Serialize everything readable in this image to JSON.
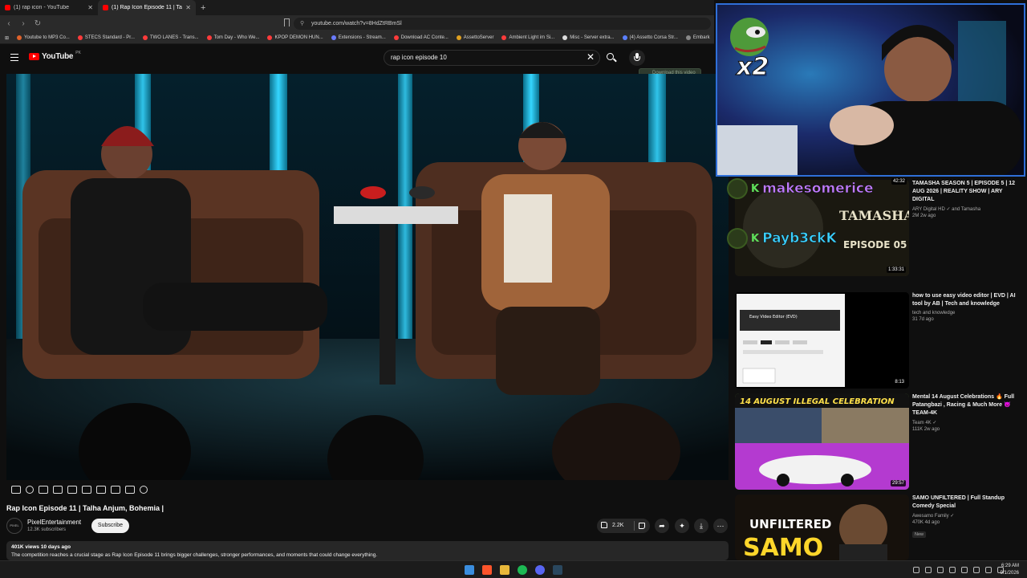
{
  "browser": {
    "tabs": [
      {
        "title": "(1) rap icon - YouTube",
        "active": false
      },
      {
        "title": "(1) Rap Icon Episode 11 | Talha A",
        "active": true
      }
    ],
    "new_tab_label": "+",
    "address": "youtube.com/watch?v=8HdZtRBmSl",
    "bookmarks": [
      {
        "label": "Youtube to MP3 Co...",
        "color": "#e0622a"
      },
      {
        "label": "STECS Standard - Pr...",
        "color": "#ff3b3b"
      },
      {
        "label": "TWO LANES - Trans...",
        "color": "#ff3b3b"
      },
      {
        "label": "Tom Day - Who We...",
        "color": "#ff3b3b"
      },
      {
        "label": "KPOP DEMON HUN...",
        "color": "#ff3b3b"
      },
      {
        "label": "Extensions - Stream...",
        "color": "#6a7bff"
      },
      {
        "label": "Download AC Conte...",
        "color": "#ff3b3b"
      },
      {
        "label": "AssettoServer",
        "color": "#e0a020"
      },
      {
        "label": "Ambient Light im Si...",
        "color": "#ff3b3b"
      },
      {
        "label": "Misc - Server extra...",
        "color": "#dddddd"
      },
      {
        "label": "(4) Assetto Corsa Str...",
        "color": "#5a7fff"
      },
      {
        "label": "Embark",
        "color": "#888888"
      }
    ]
  },
  "youtube": {
    "logo_text": "YouTube",
    "region": "PK",
    "search_value": "rap icon episode 10",
    "download_badge": "Download this video"
  },
  "video": {
    "title": "Rap Icon Episode 11 | Talha Anjum, Bohemia |",
    "channel": "PixelEntertainment",
    "avatar_text": "PIXEL",
    "subscribers": "12.3K subscribers",
    "subscribe_label": "Subscribe",
    "likes": "2.2K",
    "meta": "401K views  10 days ago",
    "description": "The competition reaches a crucial stage as Rap Icon Episode 11 brings bigger challenges, stronger performances, and moments that could change everything."
  },
  "recommendations": [
    {
      "title": "TAMASHA SEASON 5 | EPISODE 5 | 12 AUG 2026 | REALITY SHOW | ARY DIGITAL",
      "channel": "ARY Digital HD ✓ and Tamasha",
      "meta": "2M  2w ago",
      "duration": "1:33:31",
      "thumb_text": "TAMASHA",
      "thumb_sub": "EPISODE 05"
    },
    {
      "title": "how to use easy video editor | EVD | AI tool by AB | Tech and knowledge",
      "channel": "tech and knowledge",
      "meta": "31  7d ago",
      "duration": "8:13",
      "thumb_text": "Easy Video Editor (EVD)"
    },
    {
      "title": "Mental 14 August Celebrations 🔥 Full Patangbazi , Racing & Much More 😈 TEAM-4K",
      "channel": "Team 4K ✓",
      "meta": "111K  2w ago",
      "duration": "29:57",
      "thumb_text": "14 AUGUST ILLEGAL CELEBRATION"
    },
    {
      "title": "SAMO UNFILTERED | Full Standup Comedy Special",
      "channel": "Awesamo Family ✓",
      "meta": "470K  4d ago",
      "tag": "New",
      "thumb_text": "UNFILTERED",
      "thumb_sub": "SAMO"
    }
  ],
  "overlay": {
    "multiplier": "x2",
    "top_duration": "42:32",
    "chat": [
      {
        "badge": "K",
        "user": "makesomerice",
        "color": "#c07bff"
      },
      {
        "badge": "K",
        "user": "Payb3ckK",
        "color": "#3ad0ff"
      }
    ]
  },
  "taskbar": {
    "time": "6:29 AM",
    "date": "9/1/2026"
  }
}
